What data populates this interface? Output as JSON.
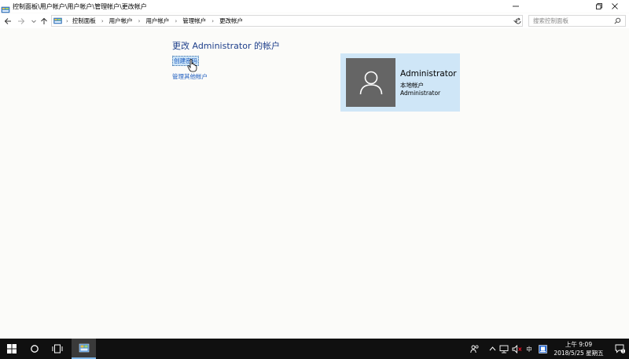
{
  "window": {
    "title": "控制面板\\用户帐户\\用户帐户\\管理帐户\\更改帐户"
  },
  "address_bar": {
    "breadcrumbs": [
      "控制面板",
      "用户帐户",
      "用户帐户",
      "管理帐户",
      "更改帐户"
    ]
  },
  "search": {
    "placeholder": "搜索控制面板"
  },
  "content": {
    "page_title": "更改 Administrator 的帐户",
    "links": {
      "create_password": "创建密码",
      "manage_other": "管理其他帐户"
    }
  },
  "account": {
    "name": "Administrator",
    "type": "本地帐户",
    "role": "Administrator",
    "card_color": "#cfe6f7",
    "avatar_color": "#656565"
  },
  "taskbar": {
    "ime": "中",
    "time": "上午 9:09",
    "date": "2018/5/25 星期五",
    "notification_count": "1"
  },
  "colors": {
    "link": "#1e5dbf",
    "title": "#1e3f8b",
    "taskbar": "#101010"
  }
}
